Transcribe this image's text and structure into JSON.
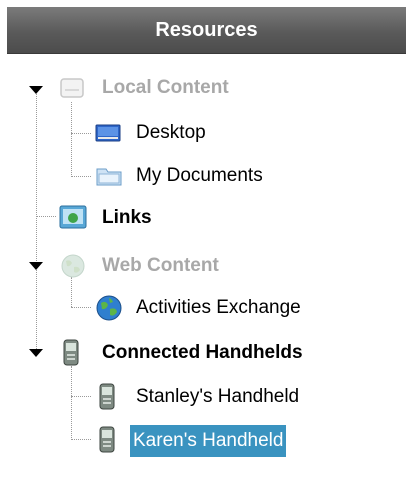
{
  "panel": {
    "title": "Resources"
  },
  "tree": {
    "local_content": {
      "label": "Local Content",
      "icon": "drive-icon",
      "expanded": true,
      "disabled": true
    },
    "desktop": {
      "label": "Desktop",
      "icon": "desktop-icon"
    },
    "my_documents": {
      "label": "My Documents",
      "icon": "folder-icon"
    },
    "links": {
      "label": "Links",
      "icon": "links-icon"
    },
    "web_content": {
      "label": "Web Content",
      "icon": "globe-icon",
      "expanded": true,
      "disabled": true
    },
    "activities_exchange": {
      "label": "Activities Exchange",
      "icon": "globe-icon"
    },
    "connected_handhelds": {
      "label": "Connected Handhelds",
      "icon": "handheld-icon",
      "expanded": true
    },
    "stanleys_handheld": {
      "label": "Stanley's Handheld",
      "icon": "handheld-icon"
    },
    "karens_handheld": {
      "label": "Karen's Handheld",
      "icon": "handheld-icon",
      "selected": true
    }
  },
  "colors": {
    "selection": "#3a93c0",
    "header": "#5a5a5a",
    "disabled_text": "#a8a8a8"
  }
}
